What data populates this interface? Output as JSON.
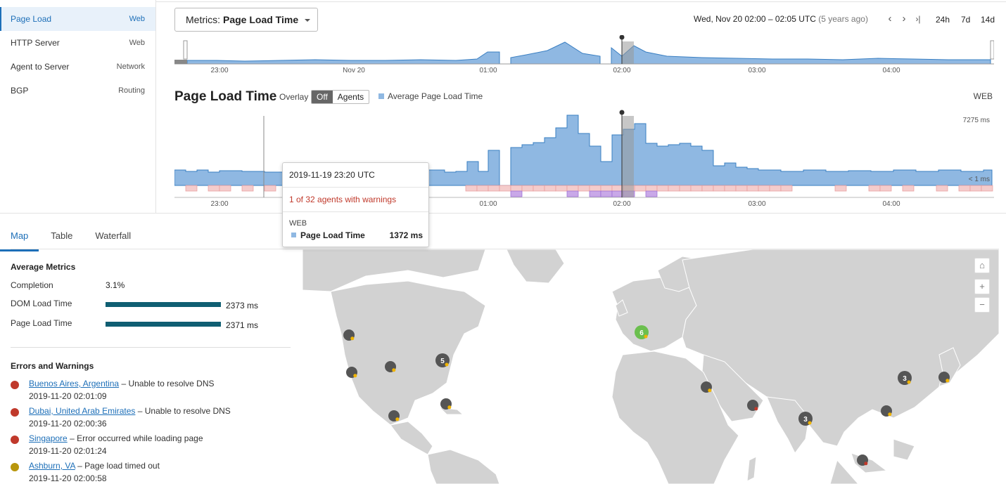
{
  "sidebar": {
    "items": [
      {
        "label": "Page Load",
        "tag": "Web",
        "active": true
      },
      {
        "label": "HTTP Server",
        "tag": "Web",
        "active": false
      },
      {
        "label": "Agent to Server",
        "tag": "Network",
        "active": false
      },
      {
        "label": "BGP",
        "tag": "Routing",
        "active": false
      }
    ]
  },
  "header": {
    "metrics_prefix": "Metrics:",
    "metrics_value": "Page Load Time",
    "timestamp": "Wed, Nov 20 02:00 – 02:05 UTC",
    "timestamp_ago": "(5 years ago)",
    "nav": {
      "prev": "‹",
      "next": "›",
      "last": "›|"
    },
    "ranges": [
      "24h",
      "7d",
      "14d"
    ]
  },
  "overview": {
    "x_labels": [
      "23:00",
      "Nov 20",
      "01:00",
      "02:00",
      "03:00",
      "04:00"
    ]
  },
  "chart": {
    "title": "Page Load Time",
    "overlay_label": "Overlay",
    "toggle_off": "Off",
    "toggle_agents": "Agents",
    "legend": "Average Page Load Time",
    "web_label": "WEB",
    "y_max_label": "7275 ms",
    "y_min_label": "< 1 ms",
    "x_labels": [
      "23:00",
      "01:00",
      "02:00",
      "03:00",
      "04:00"
    ],
    "series_color": "#8fb8e2",
    "warn_color": "#f4cccc",
    "error_color": "#c9a8e8"
  },
  "chart_data": {
    "type": "area",
    "title": "Page Load Time",
    "series": [
      {
        "name": "Average Page Load Time"
      }
    ],
    "ylim": [
      0,
      7275
    ],
    "y_unit": "ms"
  },
  "tooltip": {
    "time": "2019-11-19 23:20 UTC",
    "warning": "1 of 32 agents with warnings",
    "section": "WEB",
    "metric": "Page Load Time",
    "value": "1372 ms"
  },
  "tabs": [
    {
      "label": "Map",
      "active": true
    },
    {
      "label": "Table",
      "active": false
    },
    {
      "label": "Waterfall",
      "active": false
    }
  ],
  "metrics": {
    "title": "Average Metrics",
    "completion_label": "Completion",
    "completion_value": "3.1%",
    "dom_label": "DOM Load Time",
    "dom_value": "2373 ms",
    "dom_fraction": 1.0,
    "page_label": "Page Load Time",
    "page_value": "2371 ms",
    "page_fraction": 1.0
  },
  "errors": {
    "title": "Errors and Warnings",
    "items": [
      {
        "location": "Buenos Aires, Argentina",
        "message": "– Unable to resolve DNS",
        "time": "2019-11-20 02:01:09",
        "color": "#c0392b"
      },
      {
        "location": "Dubai, United Arab Emirates",
        "message": "– Unable to resolve DNS",
        "time": "2019-11-20 02:00:36",
        "color": "#c0392b"
      },
      {
        "location": "Singapore",
        "message": "– Error occurred while loading page",
        "time": "2019-11-20 02:01:24",
        "color": "#c0392b"
      },
      {
        "location": "Ashburn, VA",
        "message": "– Page load timed out",
        "time": "2019-11-20 02:00:58",
        "color": "#b8960c"
      }
    ]
  },
  "map": {
    "controls": {
      "home": "⌂",
      "zoom_in": "+",
      "zoom_out": "−"
    },
    "cluster_labels": [
      "6",
      "5",
      "3",
      "3"
    ]
  }
}
